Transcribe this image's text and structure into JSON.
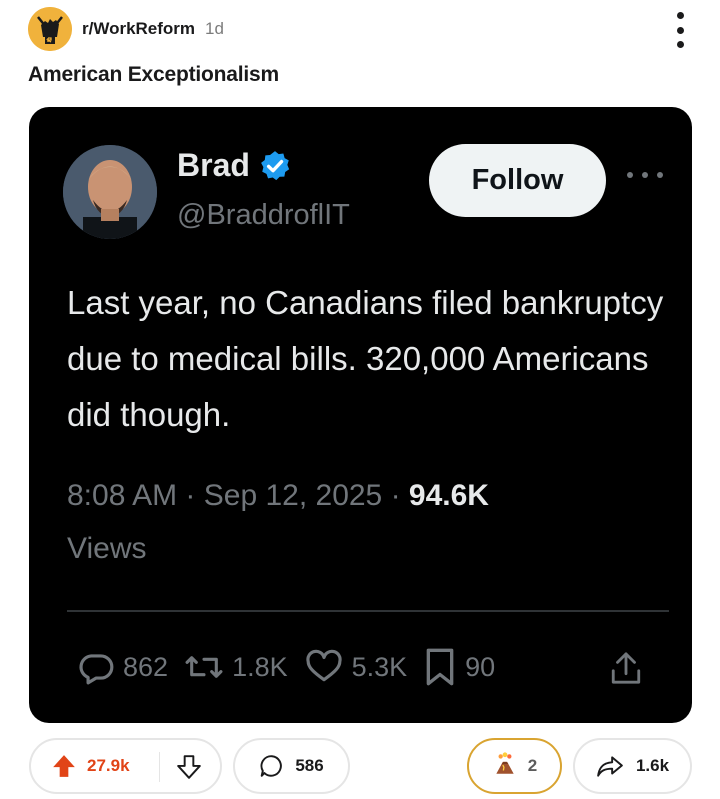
{
  "post": {
    "subreddit": "r/WorkReform",
    "age": "1d",
    "title": "American Exceptionalism"
  },
  "tweet": {
    "author_name": "Brad",
    "handle": "@BraddroflIT",
    "follow_label": "Follow",
    "text": "Last year, no Canadians filed bankruptcy due to medical bills. 320,000 Americans did though.",
    "time": "8:08 AM",
    "date": "Sep 12, 2025",
    "views_count": "94.6K",
    "views_label": "Views",
    "replies": "862",
    "reposts": "1.8K",
    "likes": "5.3K",
    "bookmarks": "90"
  },
  "actions": {
    "upvotes": "27.9k",
    "comments": "586",
    "awards": "2",
    "shares": "1.6k"
  },
  "colors": {
    "upvote": "#e14417",
    "verified": "#1d9bf0",
    "award_border": "#d9a431"
  },
  "icons": [
    "subreddit-icon",
    "kebab-menu-icon",
    "verified-icon",
    "more-icon",
    "reply-icon",
    "repost-icon",
    "like-icon",
    "bookmark-icon",
    "share-icon",
    "upvote-icon",
    "downvote-icon",
    "comment-icon",
    "award-icon",
    "share-arrow-icon"
  ]
}
